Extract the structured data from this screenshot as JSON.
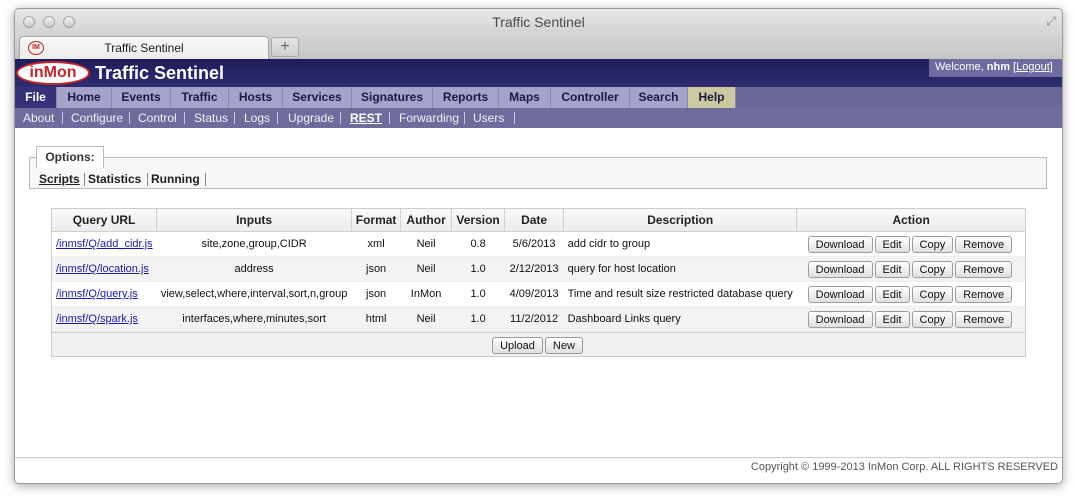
{
  "window": {
    "title": "Traffic Sentinel",
    "tab_title": "Traffic Sentinel",
    "newtab": "+"
  },
  "header": {
    "logo_text": "inMon",
    "app_title": "Traffic Sentinel",
    "welcome_prefix": "Welcome, ",
    "username": "nhm",
    "logout_label": "Logout"
  },
  "menu": [
    "File",
    "Home",
    "Events",
    "Traffic",
    "Hosts",
    "Services",
    "Signatures",
    "Reports",
    "Maps",
    "Controller",
    "Search",
    "Help"
  ],
  "submenu": [
    "About",
    "Configure",
    "Control",
    "Status",
    "Logs",
    "Upgrade",
    "REST",
    "Forwarding",
    "Users"
  ],
  "options": {
    "label": "Options:",
    "links": [
      "Scripts",
      "Statistics",
      "Running"
    ]
  },
  "table": {
    "headers": [
      "Query URL",
      "Inputs",
      "Format",
      "Author",
      "Version",
      "Date",
      "Description",
      "Action"
    ],
    "rows": [
      {
        "url": "/inmsf/Q/add_cidr.js",
        "inputs": "site,zone,group,CIDR",
        "format": "xml",
        "author": "Neil",
        "version": "0.8",
        "date": "5/6/2013",
        "description": "add cidr to group"
      },
      {
        "url": "/inmsf/Q/location.js",
        "inputs": "address",
        "format": "json",
        "author": "Neil",
        "version": "1.0",
        "date": "2/12/2013",
        "description": "query for host location"
      },
      {
        "url": "/inmsf/Q/query.js",
        "inputs": "view,select,where,interval,sort,n,group",
        "format": "json",
        "author": "InMon",
        "version": "1.0",
        "date": "4/09/2013",
        "description": "Time and result size restricted database query"
      },
      {
        "url": "/inmsf/Q/spark.js",
        "inputs": "interfaces,where,minutes,sort",
        "format": "html",
        "author": "Neil",
        "version": "1.0",
        "date": "11/2/2012",
        "description": "Dashboard Links query"
      }
    ],
    "actions": [
      "Download",
      "Edit",
      "Copy",
      "Remove"
    ],
    "footer_buttons": [
      "Upload",
      "New"
    ]
  },
  "footer": {
    "copyright": "Copyright © 1999-2013 InMon Corp. ALL RIGHTS RESERVED"
  }
}
